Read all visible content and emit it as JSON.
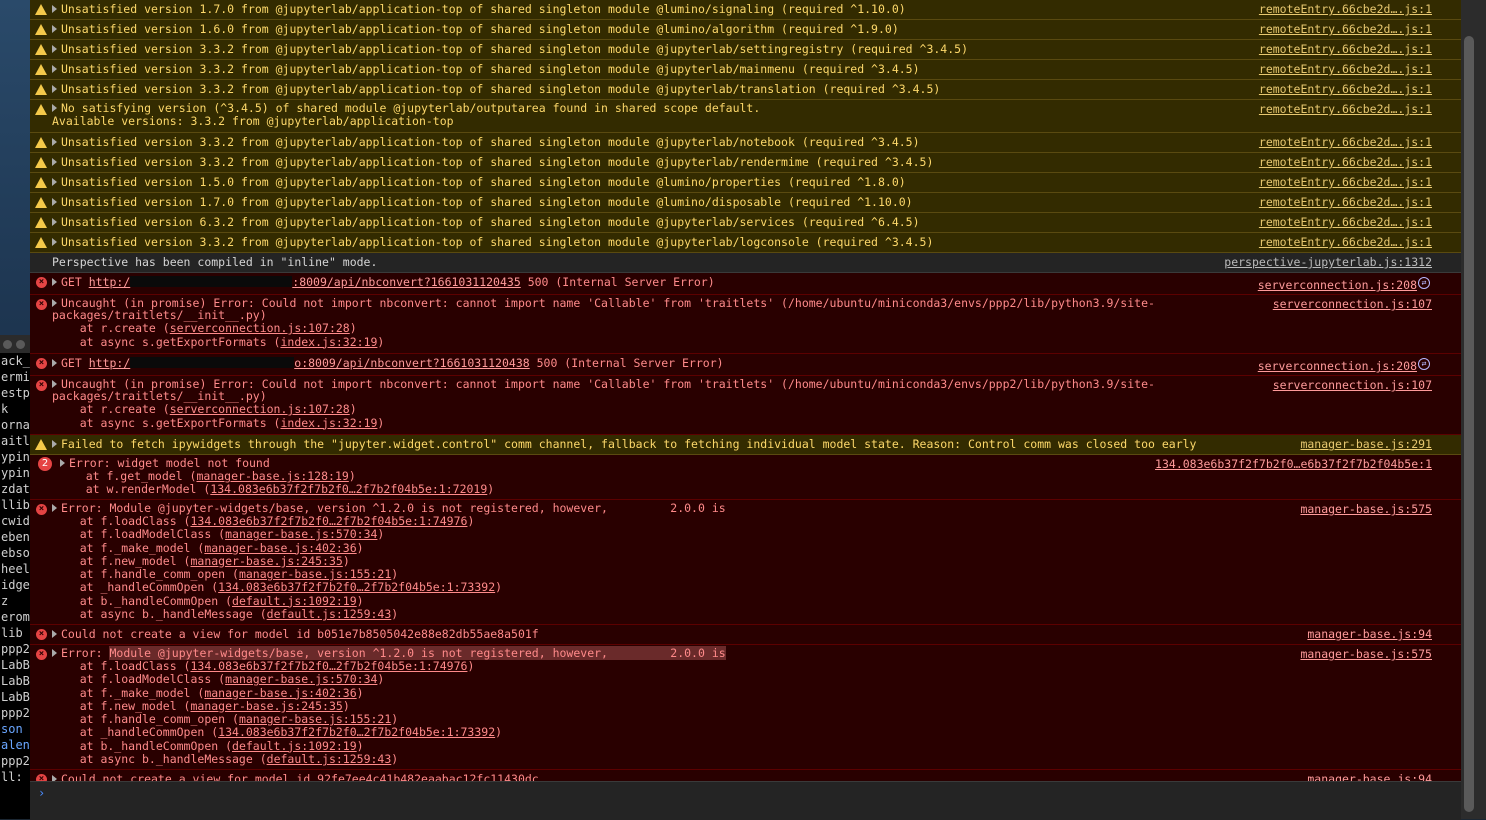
{
  "terminal": {
    "lines": [
      "ack_",
      "ermi",
      "estp",
      "k",
      "ornad",
      "aitl",
      "ypin",
      "ypin",
      "zdat",
      "llib",
      "cwid",
      "ebenc",
      "ebso",
      "heel",
      "idge",
      "z",
      "erom",
      "lib",
      "ppp2",
      "LabBu",
      "LabBu",
      "LabBu",
      "ppp2",
      "son",
      "alend",
      "ppp2",
      "ll:"
    ]
  },
  "warnings": [
    {
      "text": "Unsatisfied version 1.7.0 from @jupyterlab/application-top of shared singleton module @lumino/signaling (required ^1.10.0)",
      "src": "remoteEntry.66cbe2d….js:1"
    },
    {
      "text": "Unsatisfied version 1.6.0 from @jupyterlab/application-top of shared singleton module @lumino/algorithm (required ^1.9.0)",
      "src": "remoteEntry.66cbe2d….js:1"
    },
    {
      "text": "Unsatisfied version 3.3.2 from @jupyterlab/application-top of shared singleton module @jupyterlab/settingregistry (required ^3.4.5)",
      "src": "remoteEntry.66cbe2d….js:1"
    },
    {
      "text": "Unsatisfied version 3.3.2 from @jupyterlab/application-top of shared singleton module @jupyterlab/mainmenu (required ^3.4.5)",
      "src": "remoteEntry.66cbe2d….js:1"
    },
    {
      "text": "Unsatisfied version 3.3.2 from @jupyterlab/application-top of shared singleton module @jupyterlab/translation (required ^3.4.5)",
      "src": "remoteEntry.66cbe2d….js:1"
    }
  ],
  "no_satisfying": {
    "line1": "No satisfying version (^3.4.5) of shared module @jupyterlab/outputarea found in shared scope default.",
    "line2": "Available versions: 3.3.2 from @jupyterlab/application-top",
    "src": "remoteEntry.66cbe2d….js:1"
  },
  "warnings2": [
    {
      "text": "Unsatisfied version 3.3.2 from @jupyterlab/application-top of shared singleton module @jupyterlab/notebook (required ^3.4.5)",
      "src": "remoteEntry.66cbe2d….js:1"
    },
    {
      "text": "Unsatisfied version 3.3.2 from @jupyterlab/application-top of shared singleton module @jupyterlab/rendermime (required ^3.4.5)",
      "src": "remoteEntry.66cbe2d….js:1"
    },
    {
      "text": "Unsatisfied version 1.5.0 from @jupyterlab/application-top of shared singleton module @lumino/properties (required ^1.8.0)",
      "src": "remoteEntry.66cbe2d….js:1"
    },
    {
      "text": "Unsatisfied version 1.7.0 from @jupyterlab/application-top of shared singleton module @lumino/disposable (required ^1.10.0)",
      "src": "remoteEntry.66cbe2d….js:1"
    },
    {
      "text": "Unsatisfied version 6.3.2 from @jupyterlab/application-top of shared singleton module @jupyterlab/services (required ^6.4.5)",
      "src": "remoteEntry.66cbe2d….js:1"
    },
    {
      "text": "Unsatisfied version 3.3.2 from @jupyterlab/application-top of shared singleton module @jupyterlab/logconsole (required ^3.4.5)",
      "src": "remoteEntry.66cbe2d….js:1"
    }
  ],
  "info": {
    "text": "Perspective has been compiled in \"inline\" mode.",
    "src": "perspective-jupyterlab.js:1312"
  },
  "get1": {
    "method": "GET",
    "url_start": "http:/",
    "url_end": ":8009/api/nbconvert?1661031120435",
    "status": "500 (Internal Server Error)",
    "src": "serverconnection.js:208"
  },
  "uncaught1": {
    "line1": "Uncaught (in promise) Error: Could not import nbconvert: cannot import name 'Callable' from 'traitlets' (/home/ubuntu/miniconda3/envs/ppp2/lib/python3.9/site-",
    "line2": "packages/traitlets/__init__.py)",
    "at1_pre": "    at r.create (",
    "at1_link": "serverconnection.js:107:28",
    "at1_post": ")",
    "at2_pre": "    at async s.getExportFormats (",
    "at2_link": "index.js:32:19",
    "at2_post": ")",
    "src": "serverconnection.js:107"
  },
  "get2": {
    "method": "GET",
    "url_start": "http:/",
    "url_end": "o:8009/api/nbconvert?1661031120438",
    "status": "500 (Internal Server Error)",
    "src": "serverconnection.js:208"
  },
  "uncaught2": {
    "line1": "Uncaught (in promise) Error: Could not import nbconvert: cannot import name 'Callable' from 'traitlets' (/home/ubuntu/miniconda3/envs/ppp2/lib/python3.9/site-",
    "line2": "packages/traitlets/__init__.py)",
    "at1_pre": "    at r.create (",
    "at1_link": "serverconnection.js:107:28",
    "at1_post": ")",
    "at2_pre": "    at async s.getExportFormats (",
    "at2_link": "index.js:32:19",
    "at2_post": ")",
    "src": "serverconnection.js:107"
  },
  "ipywidgets_warn": {
    "text": "Failed to fetch ipywidgets through the \"jupyter.widget.control\" comm channel, fallback to fetching individual model state. Reason: Control comm was closed too early",
    "src": "manager-base.js:291"
  },
  "widget_notfound": {
    "count": "2",
    "line1": "Error: widget model not found",
    "at1_pre": "    at f.get_model (",
    "at1_link": "manager-base.js:128:19",
    "at1_post": ")",
    "at2_pre": "    at w.renderModel (",
    "at2_link": "134.083e6b37f2f7b2f0…2f7b2f04b5e:1:72019",
    "at2_post": ")",
    "src": "134.083e6b37f2f7b2f0…e6b37f2f7b2f04b5e:1"
  },
  "module_err1": {
    "line1": "Error: Module @jupyter-widgets/base, version ^1.2.0 is not registered, however,         2.0.0 is",
    "stack": [
      {
        "pre": "    at f.loadClass (",
        "link": "134.083e6b37f2f7b2f0…2f7b2f04b5e:1:74976",
        "post": ")"
      },
      {
        "pre": "    at f.loadModelClass (",
        "link": "manager-base.js:570:34",
        "post": ")"
      },
      {
        "pre": "    at f._make_model (",
        "link": "manager-base.js:402:36",
        "post": ")"
      },
      {
        "pre": "    at f.new_model (",
        "link": "manager-base.js:245:35",
        "post": ")"
      },
      {
        "pre": "    at f.handle_comm_open (",
        "link": "manager-base.js:155:21",
        "post": ")"
      },
      {
        "pre": "    at _handleCommOpen (",
        "link": "134.083e6b37f2f7b2f0…2f7b2f04b5e:1:73392",
        "post": ")"
      },
      {
        "pre": "    at b._handleCommOpen (",
        "link": "default.js:1092:19",
        "post": ")"
      },
      {
        "pre": "    at async b._handleMessage (",
        "link": "default.js:1259:43",
        "post": ")"
      }
    ],
    "src": "manager-base.js:575"
  },
  "view_err1": {
    "text": "Could not create a view for model id b051e7b8505042e88e82db55ae8a501f",
    "src": "manager-base.js:94"
  },
  "module_err2": {
    "prefix": "Error: ",
    "highlight": "Module @jupyter-widgets/base, version ^1.2.0 is not registered, however,         2.0.0 is",
    "stack": [
      {
        "pre": "    at f.loadClass (",
        "link": "134.083e6b37f2f7b2f0…2f7b2f04b5e:1:74976",
        "post": ")"
      },
      {
        "pre": "    at f.loadModelClass (",
        "link": "manager-base.js:570:34",
        "post": ")"
      },
      {
        "pre": "    at f._make_model (",
        "link": "manager-base.js:402:36",
        "post": ")"
      },
      {
        "pre": "    at f.new_model (",
        "link": "manager-base.js:245:35",
        "post": ")"
      },
      {
        "pre": "    at f.handle_comm_open (",
        "link": "manager-base.js:155:21",
        "post": ")"
      },
      {
        "pre": "    at _handleCommOpen (",
        "link": "134.083e6b37f2f7b2f0…2f7b2f04b5e:1:73392",
        "post": ")"
      },
      {
        "pre": "    at b._handleCommOpen (",
        "link": "default.js:1092:19",
        "post": ")"
      },
      {
        "pre": "    at async b._handleMessage (",
        "link": "default.js:1259:43",
        "post": ")"
      }
    ],
    "src": "manager-base.js:575"
  },
  "view_err2": {
    "text": "Could not create a view for model id 92fe7ee4c41b482eaabac12fc11430dc",
    "src": "manager-base.js:94"
  },
  "prompt": {
    "caret": "›"
  }
}
